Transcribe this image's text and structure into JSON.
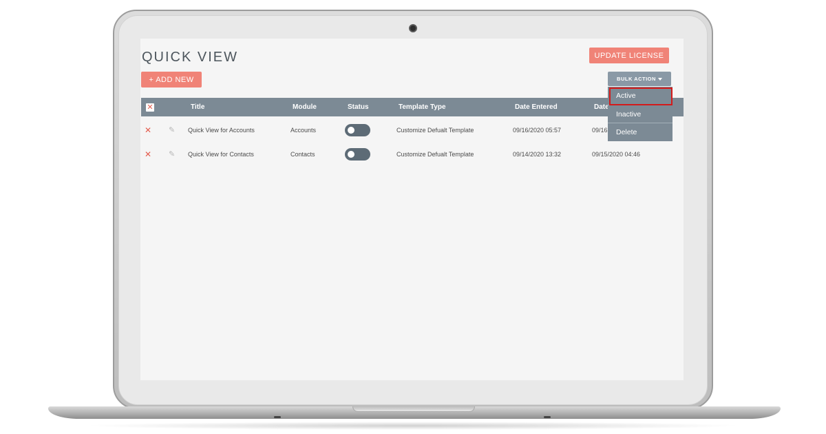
{
  "page": {
    "title": "QUICK VIEW",
    "update_license_label": "UPDATE LICENSE",
    "add_new_label": "+ ADD NEW",
    "bulk_action_label": "BULK ACTION"
  },
  "bulk_menu": {
    "items": [
      "Active",
      "Inactive",
      "Delete"
    ],
    "highlighted": "Active"
  },
  "table": {
    "columns": [
      "Title",
      "Module",
      "Status",
      "Template Type",
      "Date Entered",
      "Date"
    ],
    "rows": [
      {
        "title": "Quick View for Accounts",
        "module": "Accounts",
        "status_on": false,
        "template_type": "Customize Defualt Template",
        "date_entered": "09/16/2020 05:57",
        "date_modified": "09/16"
      },
      {
        "title": "Quick View for Contacts",
        "module": "Contacts",
        "status_on": false,
        "template_type": "Customize Defualt Template",
        "date_entered": "09/14/2020 13:32",
        "date_modified": "09/15/2020 04:46"
      }
    ]
  },
  "icons": {
    "select_all": "checkbox-x-icon",
    "row_delete": "x-icon",
    "row_edit": "pencil-icon",
    "dropdown_caret": "caret-down-icon"
  },
  "colors": {
    "accent": "#f08377",
    "header_bg": "#7c8a95",
    "toggle_bg": "#5d6b76",
    "delete_x": "#e45b4c",
    "highlight_outline": "#d41a1a"
  }
}
